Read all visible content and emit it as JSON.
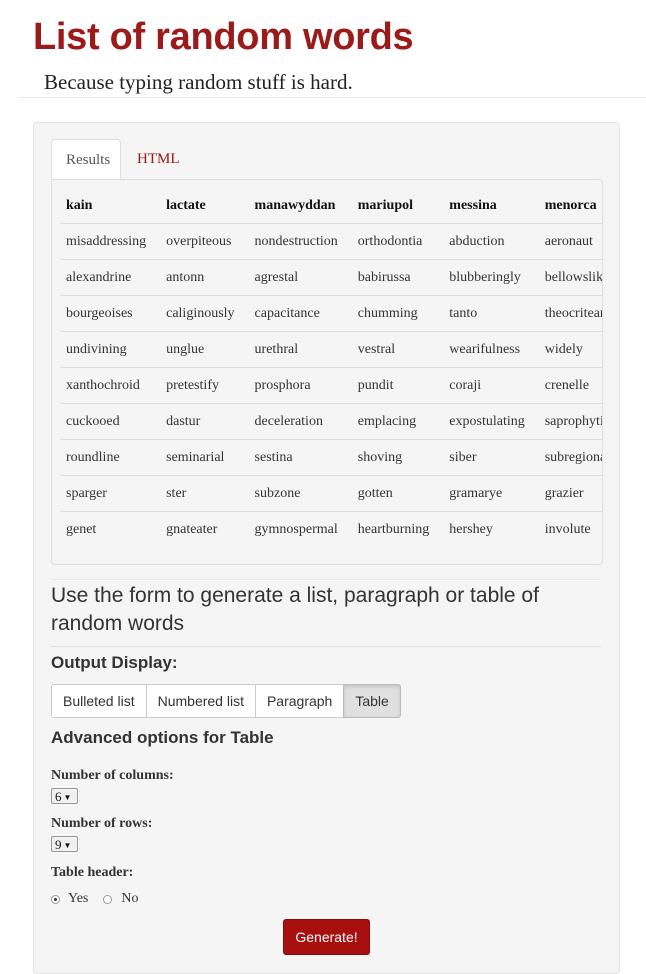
{
  "header": {
    "title": "List of random words",
    "subtitle": "Because typing random stuff is hard."
  },
  "tabs": [
    {
      "label": "Results",
      "active": true
    },
    {
      "label": "HTML",
      "active": false
    }
  ],
  "table": {
    "headers": [
      "kain",
      "lactate",
      "manawyddan",
      "mariupol",
      "messina",
      "menorca"
    ],
    "rows": [
      [
        "misaddressing",
        "overpiteous",
        "nondestruction",
        "orthodontia",
        "abduction",
        "aeronaut"
      ],
      [
        "alexandrine",
        "antonn",
        "agrestal",
        "babirussa",
        "blubberingly",
        "bellowslike"
      ],
      [
        "bourgeoises",
        "caliginously",
        "capacitance",
        "chumming",
        "tanto",
        "theocritean"
      ],
      [
        "undivining",
        "unglue",
        "urethral",
        "vestral",
        "wearifulness",
        "widely"
      ],
      [
        "xanthochroid",
        "pretestify",
        "prosphora",
        "pundit",
        "coraji",
        "crenelle"
      ],
      [
        "cuckooed",
        "dastur",
        "deceleration",
        "emplacing",
        "expostulating",
        "saprophytically"
      ],
      [
        "roundline",
        "seminarial",
        "sestina",
        "shoving",
        "siber",
        "subregional"
      ],
      [
        "sparger",
        "ster",
        "subzone",
        "gotten",
        "gramarye",
        "grazier"
      ],
      [
        "genet",
        "gnateater",
        "gymnospermal",
        "heartburning",
        "hershey",
        "involute"
      ]
    ]
  },
  "form": {
    "intro": "Use the form to generate a list, paragraph or table of random words",
    "output_heading": "Output Display:",
    "output_options": [
      {
        "label": "Bulleted list",
        "active": false
      },
      {
        "label": "Numbered list",
        "active": false
      },
      {
        "label": "Paragraph",
        "active": false
      },
      {
        "label": "Table",
        "active": true
      }
    ],
    "advanced_heading": "Advanced options for Table",
    "columns_label": "Number of columns:",
    "columns_value": "6",
    "rows_label": "Number of rows:",
    "rows_value": "9",
    "header_label": "Table header:",
    "header_yes": "Yes",
    "header_no": "No",
    "header_selected": "Yes",
    "generate_label": "Generate!"
  },
  "colors": {
    "brand": "#9b1b1b",
    "button": "#a80f0f",
    "panel_bg": "#f5f5f5"
  }
}
